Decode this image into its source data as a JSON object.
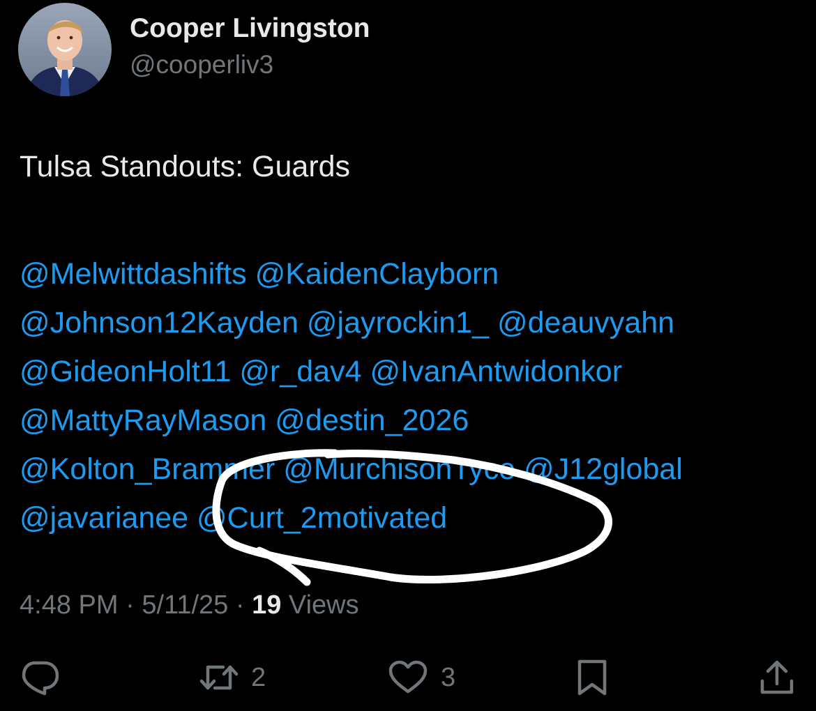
{
  "author": {
    "display_name": "Cooper Livingston",
    "handle": "@cooperliv3"
  },
  "tweet": {
    "text": "Tulsa Standouts: Guards",
    "mention_lines": [
      [
        "@Melwittdashifts",
        "@KaidenClayborn"
      ],
      [
        "@Johnson12Kayden",
        "@jayrockin1_",
        "@deauvyahn"
      ],
      [
        "@GideonHolt11",
        "@r_dav4",
        "@IvanAntwidonkor"
      ],
      [
        "@MattyRayMason",
        "@destin_2026"
      ],
      [
        "@Kolton_Brammer",
        "@MurchisonTyce",
        "@J12global"
      ],
      [
        "@javarianee",
        "@Curt_2motivated"
      ]
    ],
    "annotation": "hand-drawn white loop around @Curt_2motivated"
  },
  "meta": {
    "time": "4:48 PM",
    "separator": "·",
    "date": "5/11/25",
    "views_count": "19",
    "views_label": "Views"
  },
  "actions": {
    "reply": {
      "icon": "reply-icon"
    },
    "repost": {
      "icon": "repost-icon",
      "count": "2"
    },
    "like": {
      "icon": "heart-icon",
      "count": "3"
    },
    "bookmark": {
      "icon": "bookmark-icon"
    },
    "share": {
      "icon": "share-icon"
    }
  },
  "colors": {
    "background": "#000000",
    "text": "#e7e9ea",
    "secondary": "#71767b",
    "link": "#1d9bf0",
    "annotation": "#ffffff"
  }
}
